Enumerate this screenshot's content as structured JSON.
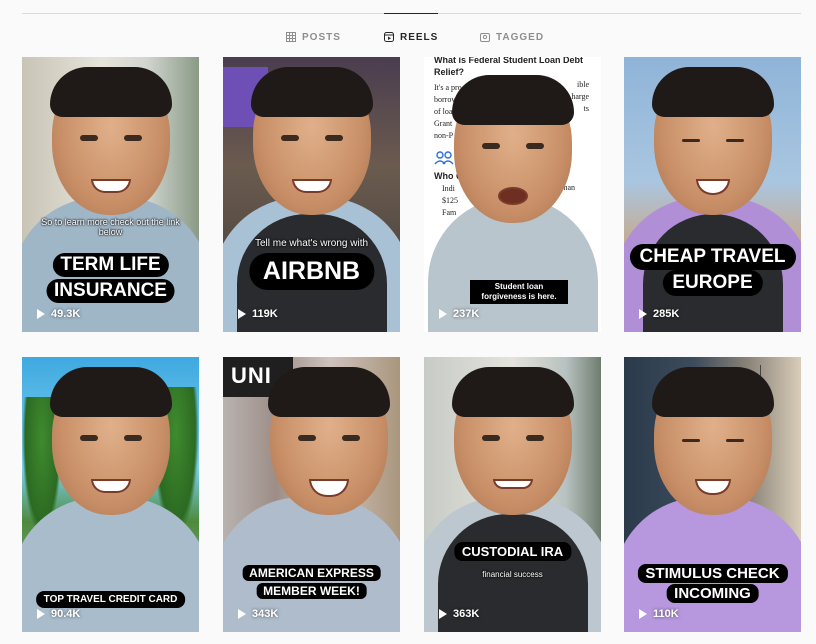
{
  "tabs": [
    {
      "label": "POSTS",
      "icon": "grid-icon",
      "active": false
    },
    {
      "label": "REELS",
      "icon": "reels-icon",
      "active": true
    },
    {
      "label": "TAGGED",
      "icon": "tagged-icon",
      "active": false
    }
  ],
  "reels": [
    {
      "small_caption": "So to learn more check out the link below",
      "big_caption": [
        "TERM LIFE",
        "INSURANCE"
      ],
      "views": "49.3K"
    },
    {
      "small_caption": "Tell me what's wrong with",
      "big_caption": [
        "AIRBNB"
      ],
      "views": "119K"
    },
    {
      "doc_title": "What is Federal Student Loan Debt Relief?",
      "doc_lines": [
        "It's a pro",
        "borrowe",
        "of loa",
        "Grant",
        "non-P"
      ],
      "doc_tail": [
        "ible",
        "harge",
        "ts"
      ],
      "doc_heading": "Who Qu",
      "doc_bullets": [
        "Indi",
        "$125",
        "Fam"
      ],
      "doc_bullet_tail": "han",
      "caption": "Student loan forgiveness is here.",
      "views": "237K"
    },
    {
      "big_caption": [
        "CHEAP TRAVEL",
        "EUROPE"
      ],
      "views": "285K"
    },
    {
      "big_caption": [
        "TOP TRAVEL CREDIT CARD"
      ],
      "views": "90.4K"
    },
    {
      "sign_text": "UNI",
      "big_caption": [
        "AMERICAN EXPRESS",
        "MEMBER WEEK!"
      ],
      "views": "343K"
    },
    {
      "big_caption": [
        "CUSTODIAL IRA"
      ],
      "small_caption": "financial success",
      "views": "363K"
    },
    {
      "big_caption": [
        "STIMULUS CHECK",
        "INCOMING"
      ],
      "views": "110K"
    }
  ],
  "colors": {
    "accent_active": "#262626",
    "inactive": "#8e8e8e",
    "caption_bg": "#000000"
  }
}
